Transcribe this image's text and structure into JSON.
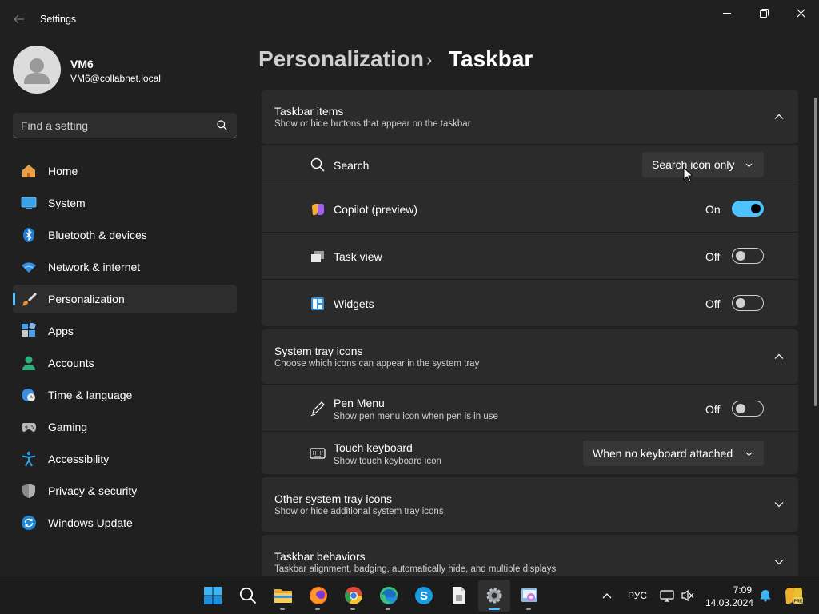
{
  "window": {
    "app_title": "Settings",
    "back_icon": "back-arrow-icon",
    "minimize_icon": "minimize-icon",
    "restore_icon": "restore-icon",
    "close_icon": "close-icon"
  },
  "user": {
    "name": "VM6",
    "email": "VM6@collabnet.local"
  },
  "search": {
    "placeholder": "Find a setting",
    "value": ""
  },
  "sidebar": {
    "items": [
      {
        "label": "Home",
        "icon": "home-icon"
      },
      {
        "label": "System",
        "icon": "system-icon"
      },
      {
        "label": "Bluetooth & devices",
        "icon": "bluetooth-icon"
      },
      {
        "label": "Network & internet",
        "icon": "wifi-icon"
      },
      {
        "label": "Personalization",
        "icon": "paintbrush-icon",
        "active": true
      },
      {
        "label": "Apps",
        "icon": "apps-icon"
      },
      {
        "label": "Accounts",
        "icon": "accounts-icon"
      },
      {
        "label": "Time & language",
        "icon": "clock-globe-icon"
      },
      {
        "label": "Gaming",
        "icon": "controller-icon"
      },
      {
        "label": "Accessibility",
        "icon": "accessibility-icon"
      },
      {
        "label": "Privacy & security",
        "icon": "shield-icon"
      },
      {
        "label": "Windows Update",
        "icon": "windows-update-icon"
      }
    ]
  },
  "header": {
    "parent": "Personalization",
    "separator": "›",
    "current": "Taskbar"
  },
  "sections": {
    "taskbar_items": {
      "title": "Taskbar items",
      "subtitle": "Show or hide buttons that appear on the taskbar",
      "expanded": true,
      "rows": {
        "search": {
          "label": "Search",
          "icon": "search-icon",
          "value": "Search icon only"
        },
        "copilot": {
          "label": "Copilot (preview)",
          "icon": "copilot-icon",
          "state": "On",
          "enabled": true
        },
        "task_view": {
          "label": "Task view",
          "icon": "task-view-icon",
          "state": "Off",
          "enabled": false
        },
        "widgets": {
          "label": "Widgets",
          "icon": "widgets-icon",
          "state": "Off",
          "enabled": false
        }
      }
    },
    "system_tray": {
      "title": "System tray icons",
      "subtitle": "Choose which icons can appear in the system tray",
      "expanded": true,
      "rows": {
        "pen_menu": {
          "label": "Pen Menu",
          "sub": "Show pen menu icon when pen is in use",
          "icon": "pen-icon",
          "state": "Off",
          "enabled": false
        },
        "touch_keyboard": {
          "label": "Touch keyboard",
          "sub": "Show touch keyboard icon",
          "icon": "keyboard-icon",
          "value": "When no keyboard attached"
        }
      }
    },
    "other_tray": {
      "title": "Other system tray icons",
      "subtitle": "Show or hide additional system tray icons",
      "expanded": false
    },
    "behaviors": {
      "title": "Taskbar behaviors",
      "subtitle": "Taskbar alignment, badging, automatically hide, and multiple displays",
      "expanded": false
    }
  },
  "taskbar": {
    "apps": [
      "start-icon",
      "search-icon",
      "file-explorer-icon",
      "firefox-icon",
      "chrome-icon",
      "edge-icon",
      "skype-icon",
      "document-icon",
      "settings-icon",
      "control-panel-icon"
    ],
    "language": "РУС",
    "time": "7:09",
    "date": "14.03.2024"
  },
  "colors": {
    "accent": "#4cc2ff",
    "background": "#202020",
    "card": "#2b2b2b"
  }
}
